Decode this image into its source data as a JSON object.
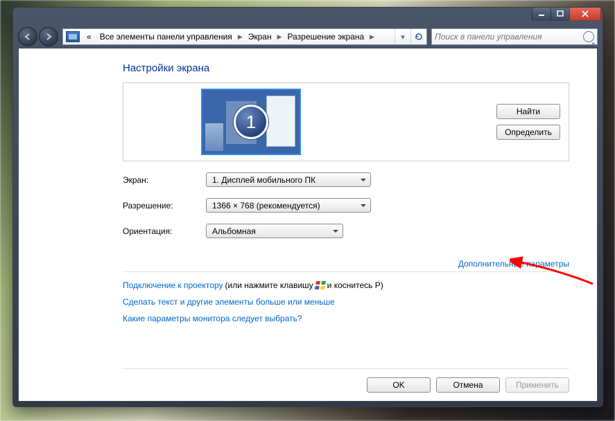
{
  "breadcrumb": {
    "prefix": "«",
    "items": [
      "Все элементы панели управления",
      "Экран",
      "Разрешение экрана"
    ]
  },
  "search": {
    "placeholder": "Поиск в панели управления"
  },
  "heading": "Настройки экрана",
  "monitor_number": "1",
  "buttons": {
    "detect": "Найти",
    "identify": "Определить",
    "ok": "OK",
    "cancel": "Отмена",
    "apply": "Применить"
  },
  "labels": {
    "display": "Экран:",
    "resolution": "Разрешение:",
    "orientation": "Ориентация:"
  },
  "values": {
    "display": "1. Дисплей мобильного ПК",
    "resolution": "1366 × 768 (рекомендуется)",
    "orientation": "Альбомная"
  },
  "advanced_link": "Дополнительные параметры",
  "links": {
    "projector_link": "Подключение к проектору",
    "projector_suffix_a": " (или нажмите клавишу ",
    "projector_suffix_b": " и коснитесь P)",
    "text_size": "Сделать текст и другие элементы больше или меньше",
    "which_monitor": "Какие параметры монитора следует выбрать?"
  }
}
